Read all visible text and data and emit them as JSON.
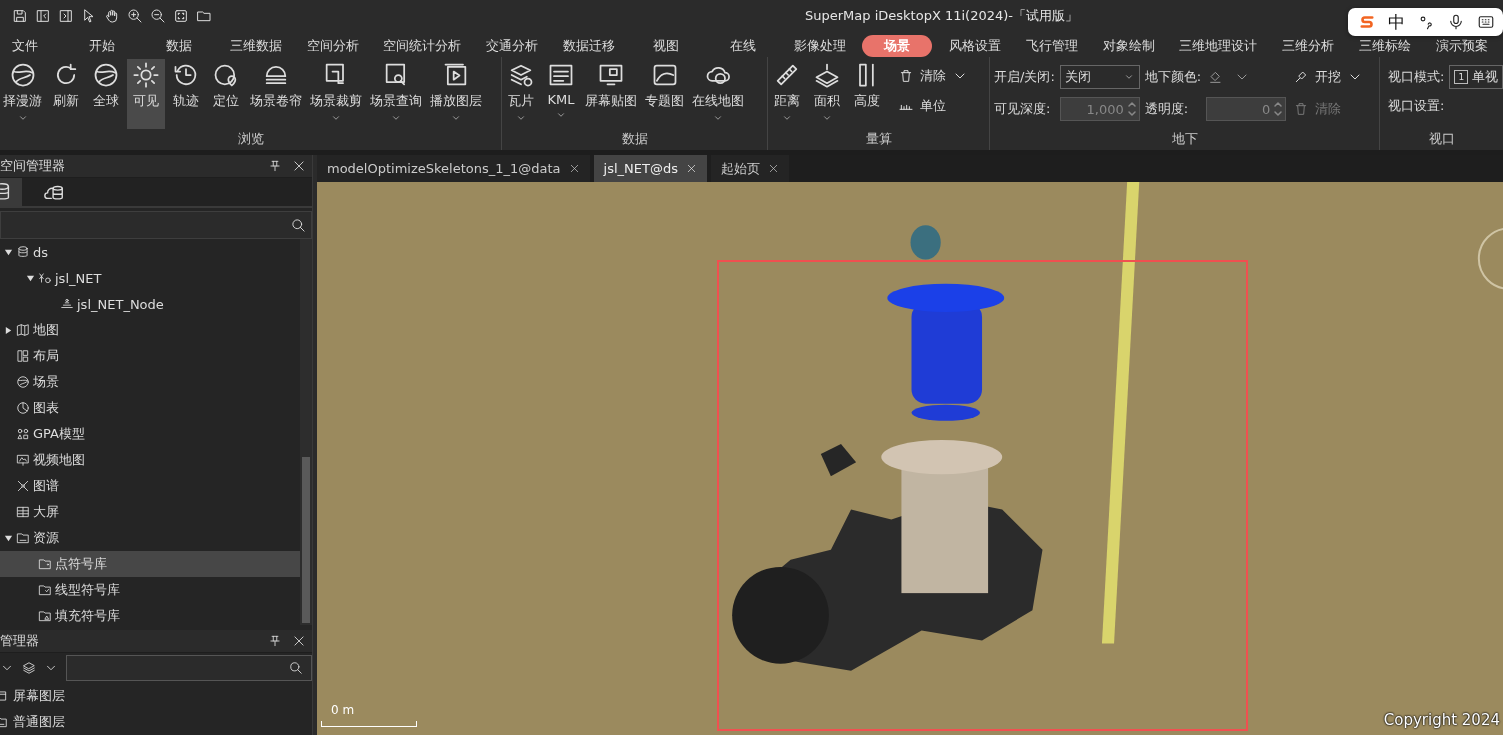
{
  "window": {
    "title": "SuperMap iDesktopX 11i(2024)-「试用版」"
  },
  "ime_toolbar": {
    "mode": "中"
  },
  "menu_tabs": [
    {
      "label": "文件",
      "selected": false
    },
    {
      "label": "开始",
      "selected": false
    },
    {
      "label": "数据",
      "selected": false
    },
    {
      "label": "三维数据",
      "selected": false
    },
    {
      "label": "空间分析",
      "selected": false
    },
    {
      "label": "空间统计分析",
      "selected": false
    },
    {
      "label": "交通分析",
      "selected": false
    },
    {
      "label": "数据迁移",
      "selected": false
    },
    {
      "label": "视图",
      "selected": false
    },
    {
      "label": "在线",
      "selected": false
    },
    {
      "label": "影像处理",
      "selected": false
    },
    {
      "label": "场景",
      "selected": true
    },
    {
      "label": "风格设置",
      "selected": false
    },
    {
      "label": "飞行管理",
      "selected": false
    },
    {
      "label": "对象绘制",
      "selected": false
    },
    {
      "label": "三维地理设计",
      "selected": false
    },
    {
      "label": "三维分析",
      "selected": false
    },
    {
      "label": "三维标绘",
      "selected": false
    },
    {
      "label": "演示预案",
      "selected": false
    }
  ],
  "ribbon": {
    "groups": [
      {
        "label": "浏览",
        "items": [
          {
            "kind": "large",
            "label": "择漫游",
            "dropdown": true,
            "selected": false
          },
          {
            "kind": "large",
            "label": "刷新",
            "dropdown": false,
            "selected": false
          },
          {
            "kind": "large",
            "label": "全球",
            "dropdown": false,
            "selected": false
          },
          {
            "kind": "large",
            "label": "可见",
            "dropdown": false,
            "selected": true
          },
          {
            "kind": "large",
            "label": "轨迹",
            "dropdown": false,
            "selected": false
          },
          {
            "kind": "large",
            "label": "定位",
            "dropdown": false,
            "selected": false
          },
          {
            "kind": "large",
            "label": "场景卷帘",
            "dropdown": false,
            "selected": false
          },
          {
            "kind": "large",
            "label": "场景裁剪",
            "dropdown": true,
            "selected": false
          },
          {
            "kind": "large",
            "label": "场景查询",
            "dropdown": true,
            "selected": false
          },
          {
            "kind": "large",
            "label": "播放图层",
            "dropdown": true,
            "selected": false
          }
        ]
      },
      {
        "label": "数据",
        "items": [
          {
            "kind": "large",
            "label": "瓦片",
            "dropdown": true,
            "selected": false
          },
          {
            "kind": "large",
            "label": "KML",
            "dropdown": true,
            "selected": false
          },
          {
            "kind": "large",
            "label": "屏幕贴图",
            "dropdown": false,
            "selected": false
          },
          {
            "kind": "large",
            "label": "专题图",
            "dropdown": false,
            "selected": false
          },
          {
            "kind": "large",
            "label": "在线地图",
            "dropdown": true,
            "selected": false
          }
        ]
      },
      {
        "label": "量算",
        "items": [
          {
            "kind": "large",
            "label": "距离",
            "dropdown": true,
            "selected": false
          },
          {
            "kind": "large",
            "label": "面积",
            "dropdown": true,
            "selected": false
          },
          {
            "kind": "large",
            "label": "高度",
            "dropdown": false,
            "selected": false
          },
          {
            "kind": "small",
            "label": "清除",
            "dropdown": true,
            "selected": false
          },
          {
            "kind": "small",
            "label": "单位",
            "dropdown": false,
            "selected": false
          }
        ]
      },
      {
        "label": "地下",
        "fields": [
          {
            "kind": "select",
            "label": "开启/关闭:",
            "value": "关闭"
          },
          {
            "kind": "color",
            "label": "地下颜色:"
          },
          {
            "kind": "tool",
            "label": "开挖",
            "dropdown": true,
            "disabled": false
          },
          {
            "kind": "spin",
            "label": "可见深度:",
            "value": "1,000",
            "disabled": true
          },
          {
            "kind": "spin",
            "label": "透明度:",
            "value": "0",
            "disabled": true
          },
          {
            "kind": "tool",
            "label": "清除",
            "dropdown": false,
            "disabled": true
          }
        ]
      },
      {
        "label": "视口",
        "fields": [
          {
            "kind": "mode",
            "label": "视口模式:",
            "pane_count": "1",
            "value": "单视"
          },
          {
            "kind": "label",
            "label": "视口设置:"
          }
        ]
      }
    ]
  },
  "workspace_panel": {
    "title": "空间管理器",
    "tabs": [
      {
        "selected": true
      },
      {
        "selected": false
      }
    ],
    "tree": [
      {
        "kind": "datasource",
        "label": "ds",
        "expanded": true,
        "selected": false,
        "children": [
          {
            "kind": "network",
            "label": "jsl_NET",
            "expanded": true,
            "selected": false,
            "children": [
              {
                "kind": "point",
                "label": "jsl_NET_Node",
                "selected": false
              }
            ]
          }
        ]
      },
      {
        "kind": "map",
        "label": "地图",
        "expanded": false,
        "selected": false
      },
      {
        "kind": "layout",
        "label": "布局",
        "selected": false
      },
      {
        "kind": "scene",
        "label": "场景",
        "selected": false
      },
      {
        "kind": "chart",
        "label": "图表",
        "selected": false
      },
      {
        "kind": "model",
        "label": "GPA模型",
        "selected": false
      },
      {
        "kind": "video",
        "label": "视频地图",
        "selected": false
      },
      {
        "kind": "graph",
        "label": "图谱",
        "selected": false
      },
      {
        "kind": "screen",
        "label": "大屏",
        "selected": false
      },
      {
        "kind": "folder",
        "label": "资源",
        "expanded": true,
        "selected": false,
        "children": [
          {
            "kind": "point-lib",
            "label": "点符号库",
            "selected": true
          },
          {
            "kind": "line-lib",
            "label": "线型符号库",
            "selected": false
          },
          {
            "kind": "fill-lib",
            "label": "填充符号库",
            "selected": false
          }
        ]
      }
    ]
  },
  "layer_panel": {
    "title": "管理器",
    "layers": [
      {
        "kind": "screen",
        "label": "屏幕图层"
      },
      {
        "kind": "normal",
        "label": "普通图层"
      }
    ]
  },
  "document_tabs": [
    {
      "label": "modelOptimizeSkeletons_1_1@data",
      "selected": false
    },
    {
      "label": "jsl_NET@ds",
      "selected": true
    },
    {
      "label": "起始页",
      "selected": false
    }
  ],
  "scene": {
    "kind": "picture",
    "scale_label": "0 m",
    "copyright": "Copyright 2024"
  }
}
